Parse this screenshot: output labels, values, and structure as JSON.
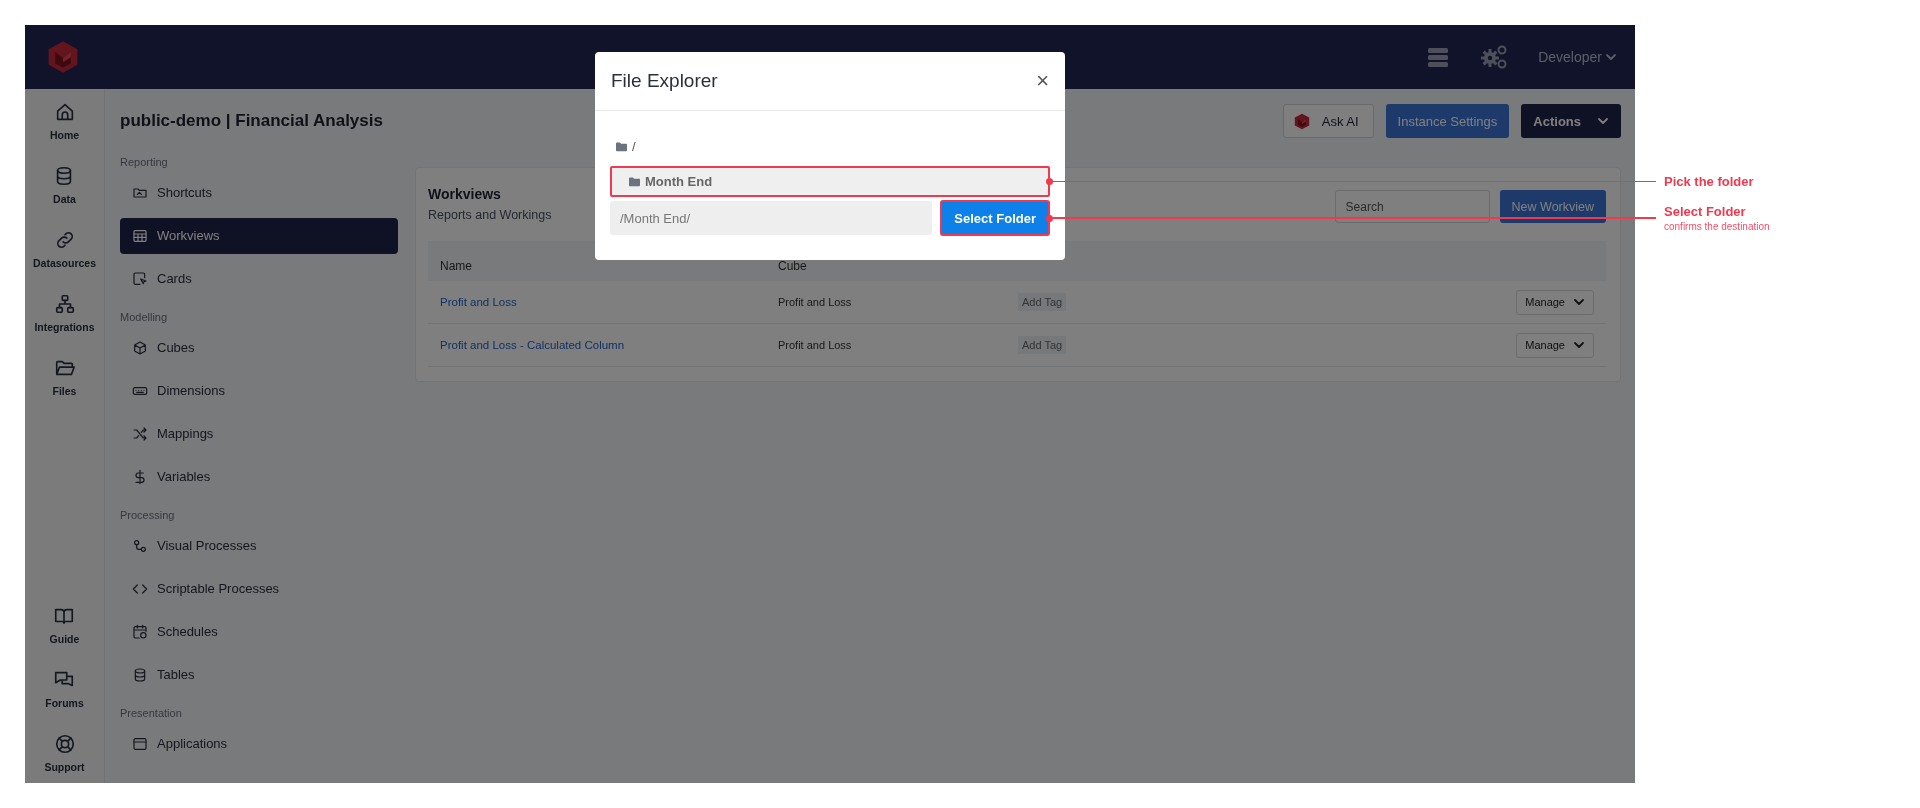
{
  "topbar": {
    "user_menu": "Developer"
  },
  "rail": {
    "items": [
      {
        "label": "Home"
      },
      {
        "label": "Data"
      },
      {
        "label": "Datasources"
      },
      {
        "label": "Integrations"
      },
      {
        "label": "Files"
      }
    ],
    "bottom_items": [
      {
        "label": "Guide"
      },
      {
        "label": "Forums"
      },
      {
        "label": "Support"
      }
    ]
  },
  "page_title": "public-demo | Financial Analysis",
  "header_buttons": [
    {
      "kind": "ai",
      "label": "Ask AI"
    },
    {
      "kind": "primary",
      "label": "Instance Settings"
    },
    {
      "kind": "dropdown",
      "label": "Actions"
    }
  ],
  "sidebar": {
    "sections": [
      {
        "title": "Reporting",
        "items": [
          {
            "label": "Shortcuts",
            "selected": false
          },
          {
            "label": "Workviews",
            "selected": true
          },
          {
            "label": "Cards",
            "selected": false
          }
        ]
      },
      {
        "title": "Modelling",
        "items": [
          {
            "label": "Cubes",
            "selected": false
          },
          {
            "label": "Dimensions",
            "selected": false
          },
          {
            "label": "Mappings",
            "selected": false
          },
          {
            "label": "Variables",
            "selected": false
          }
        ]
      },
      {
        "title": "Processing",
        "items": [
          {
            "label": "Visual Processes",
            "selected": false
          },
          {
            "label": "Scriptable Processes",
            "selected": false
          },
          {
            "label": "Schedules",
            "selected": false
          },
          {
            "label": "Tables",
            "selected": false
          }
        ]
      },
      {
        "title": "Presentation",
        "items": [
          {
            "label": "Applications",
            "selected": false
          }
        ]
      }
    ]
  },
  "card": {
    "title": "Workviews",
    "subtitle": "Reports and Workings",
    "search": {
      "placeholder": "Search"
    },
    "new_button": "New Workview",
    "table": {
      "columns": [
        "Name",
        "Cube"
      ],
      "rows": [
        {
          "name": "Profit and Loss",
          "cube": "Profit and Loss",
          "tag_button": "Add Tag",
          "manage": "Manage"
        },
        {
          "name": "Profit and Loss - Calculated Column",
          "cube": "Profit and Loss",
          "tag_button": "Add Tag",
          "manage": "Manage"
        }
      ]
    }
  },
  "modal": {
    "title": "File Explorer",
    "close": "×",
    "root": "/",
    "folders": [
      {
        "label": "Month End",
        "highlighted": true
      }
    ],
    "path": {
      "value": "/Month End/"
    },
    "select_button": {
      "label": "Select Folder",
      "highlighted": true
    }
  },
  "callouts": [
    {
      "kind": "row",
      "title": "Pick the folder"
    },
    {
      "kind": "button",
      "title": "Select Folder",
      "note": "confirms the destination"
    }
  ]
}
